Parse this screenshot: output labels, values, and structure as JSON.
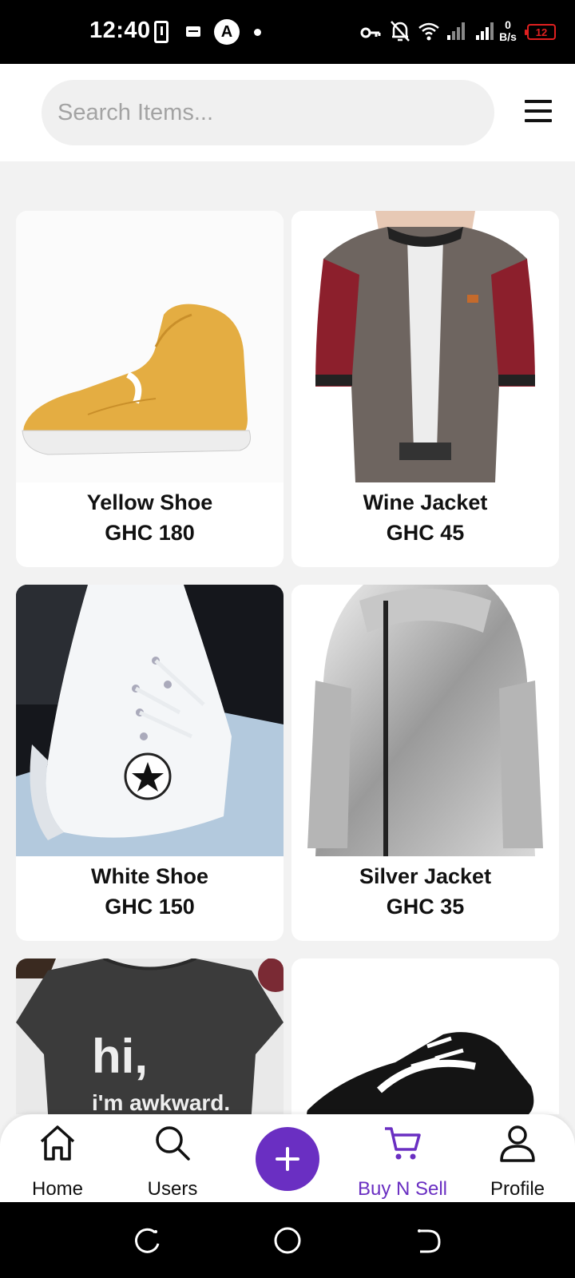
{
  "status_bar": {
    "time": "12:40",
    "circle_icon_letter": "A",
    "net_speed_value": "0",
    "net_speed_unit": "B/s",
    "battery_level": "12"
  },
  "header": {
    "search_placeholder": "Search Items..."
  },
  "products": [
    {
      "name": "Yellow Shoe",
      "price": "GHC 180",
      "image": "yellow-shoe"
    },
    {
      "name": "Wine Jacket",
      "price": "GHC 45",
      "image": "wine-jacket"
    },
    {
      "name": "White Shoe",
      "price": "GHC 150",
      "image": "white-shoe"
    },
    {
      "name": "Silver Jacket",
      "price": "GHC 35",
      "image": "silver-jacket"
    },
    {
      "name": "",
      "price": "",
      "image": "tshirt",
      "shirt_text_1": "hi,",
      "shirt_text_2": "i'm awkward."
    },
    {
      "name": "",
      "price": "",
      "image": "black-sneakers"
    }
  ],
  "bottom_nav": {
    "items": [
      {
        "label": "Home",
        "icon": "home-icon"
      },
      {
        "label": "Users",
        "icon": "search-icon"
      },
      {
        "label": "Buy N Sell",
        "icon": "cart-icon",
        "active": true
      },
      {
        "label": "Profile",
        "icon": "person-icon"
      }
    ],
    "fab_icon": "plus-icon"
  },
  "colors": {
    "accent": "#6a2fc2",
    "background": "#f2f2f2",
    "battery_low": "#e02020"
  }
}
